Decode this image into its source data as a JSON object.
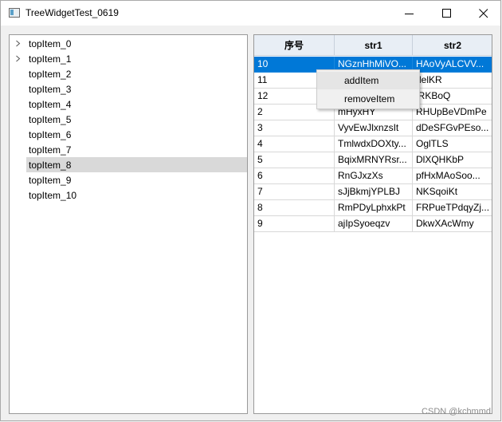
{
  "window": {
    "title": "TreeWidgetTest_0619"
  },
  "tree": {
    "items": [
      {
        "label": "topItem_0",
        "expandable": true,
        "selected": false
      },
      {
        "label": "topItem_1",
        "expandable": true,
        "selected": false
      },
      {
        "label": "topItem_2",
        "expandable": false,
        "selected": false
      },
      {
        "label": "topItem_3",
        "expandable": false,
        "selected": false
      },
      {
        "label": "topItem_4",
        "expandable": false,
        "selected": false
      },
      {
        "label": "topItem_5",
        "expandable": false,
        "selected": false
      },
      {
        "label": "topItem_6",
        "expandable": false,
        "selected": false
      },
      {
        "label": "topItem_7",
        "expandable": false,
        "selected": false
      },
      {
        "label": "topItem_8",
        "expandable": false,
        "selected": true
      },
      {
        "label": "topItem_9",
        "expandable": false,
        "selected": false
      },
      {
        "label": "topItem_10",
        "expandable": false,
        "selected": false
      }
    ]
  },
  "table": {
    "headers": [
      "序号",
      "str1",
      "str2"
    ],
    "rows": [
      {
        "cells": [
          "10",
          "NGznHhMiVO...",
          "HAoVyALCVV..."
        ],
        "selected": true
      },
      {
        "cells": [
          "11",
          "",
          "delKR"
        ],
        "selected": false
      },
      {
        "cells": [
          "12",
          "",
          "lRKBoQ"
        ],
        "selected": false
      },
      {
        "cells": [
          "2",
          "mHyxHY",
          "RHUpBeVDmPe"
        ],
        "selected": false
      },
      {
        "cells": [
          "3",
          "VyvEwJlxnzsIt",
          "dDeSFGvPEso..."
        ],
        "selected": false
      },
      {
        "cells": [
          "4",
          "TmlwdxDOXty...",
          "OglTLS"
        ],
        "selected": false
      },
      {
        "cells": [
          "5",
          "BqixMRNYRsr...",
          "DlXQHKbP"
        ],
        "selected": false
      },
      {
        "cells": [
          "6",
          "RnGJxzXs",
          "pfHxMAoSoo..."
        ],
        "selected": false
      },
      {
        "cells": [
          "7",
          "sJjBkmjYPLBJ",
          "NKSqoiKt"
        ],
        "selected": false
      },
      {
        "cells": [
          "8",
          "RmPDyLphxkPt",
          "FRPueTPdqyZj..."
        ],
        "selected": false
      },
      {
        "cells": [
          "9",
          "ajIpSyoeqzv",
          "DkwXAcWmy"
        ],
        "selected": false
      }
    ]
  },
  "context_menu": {
    "items": [
      {
        "label": "addItem",
        "hover": true
      },
      {
        "label": "removeItem",
        "hover": false
      }
    ]
  },
  "watermark": "CSDN @kchmmd"
}
